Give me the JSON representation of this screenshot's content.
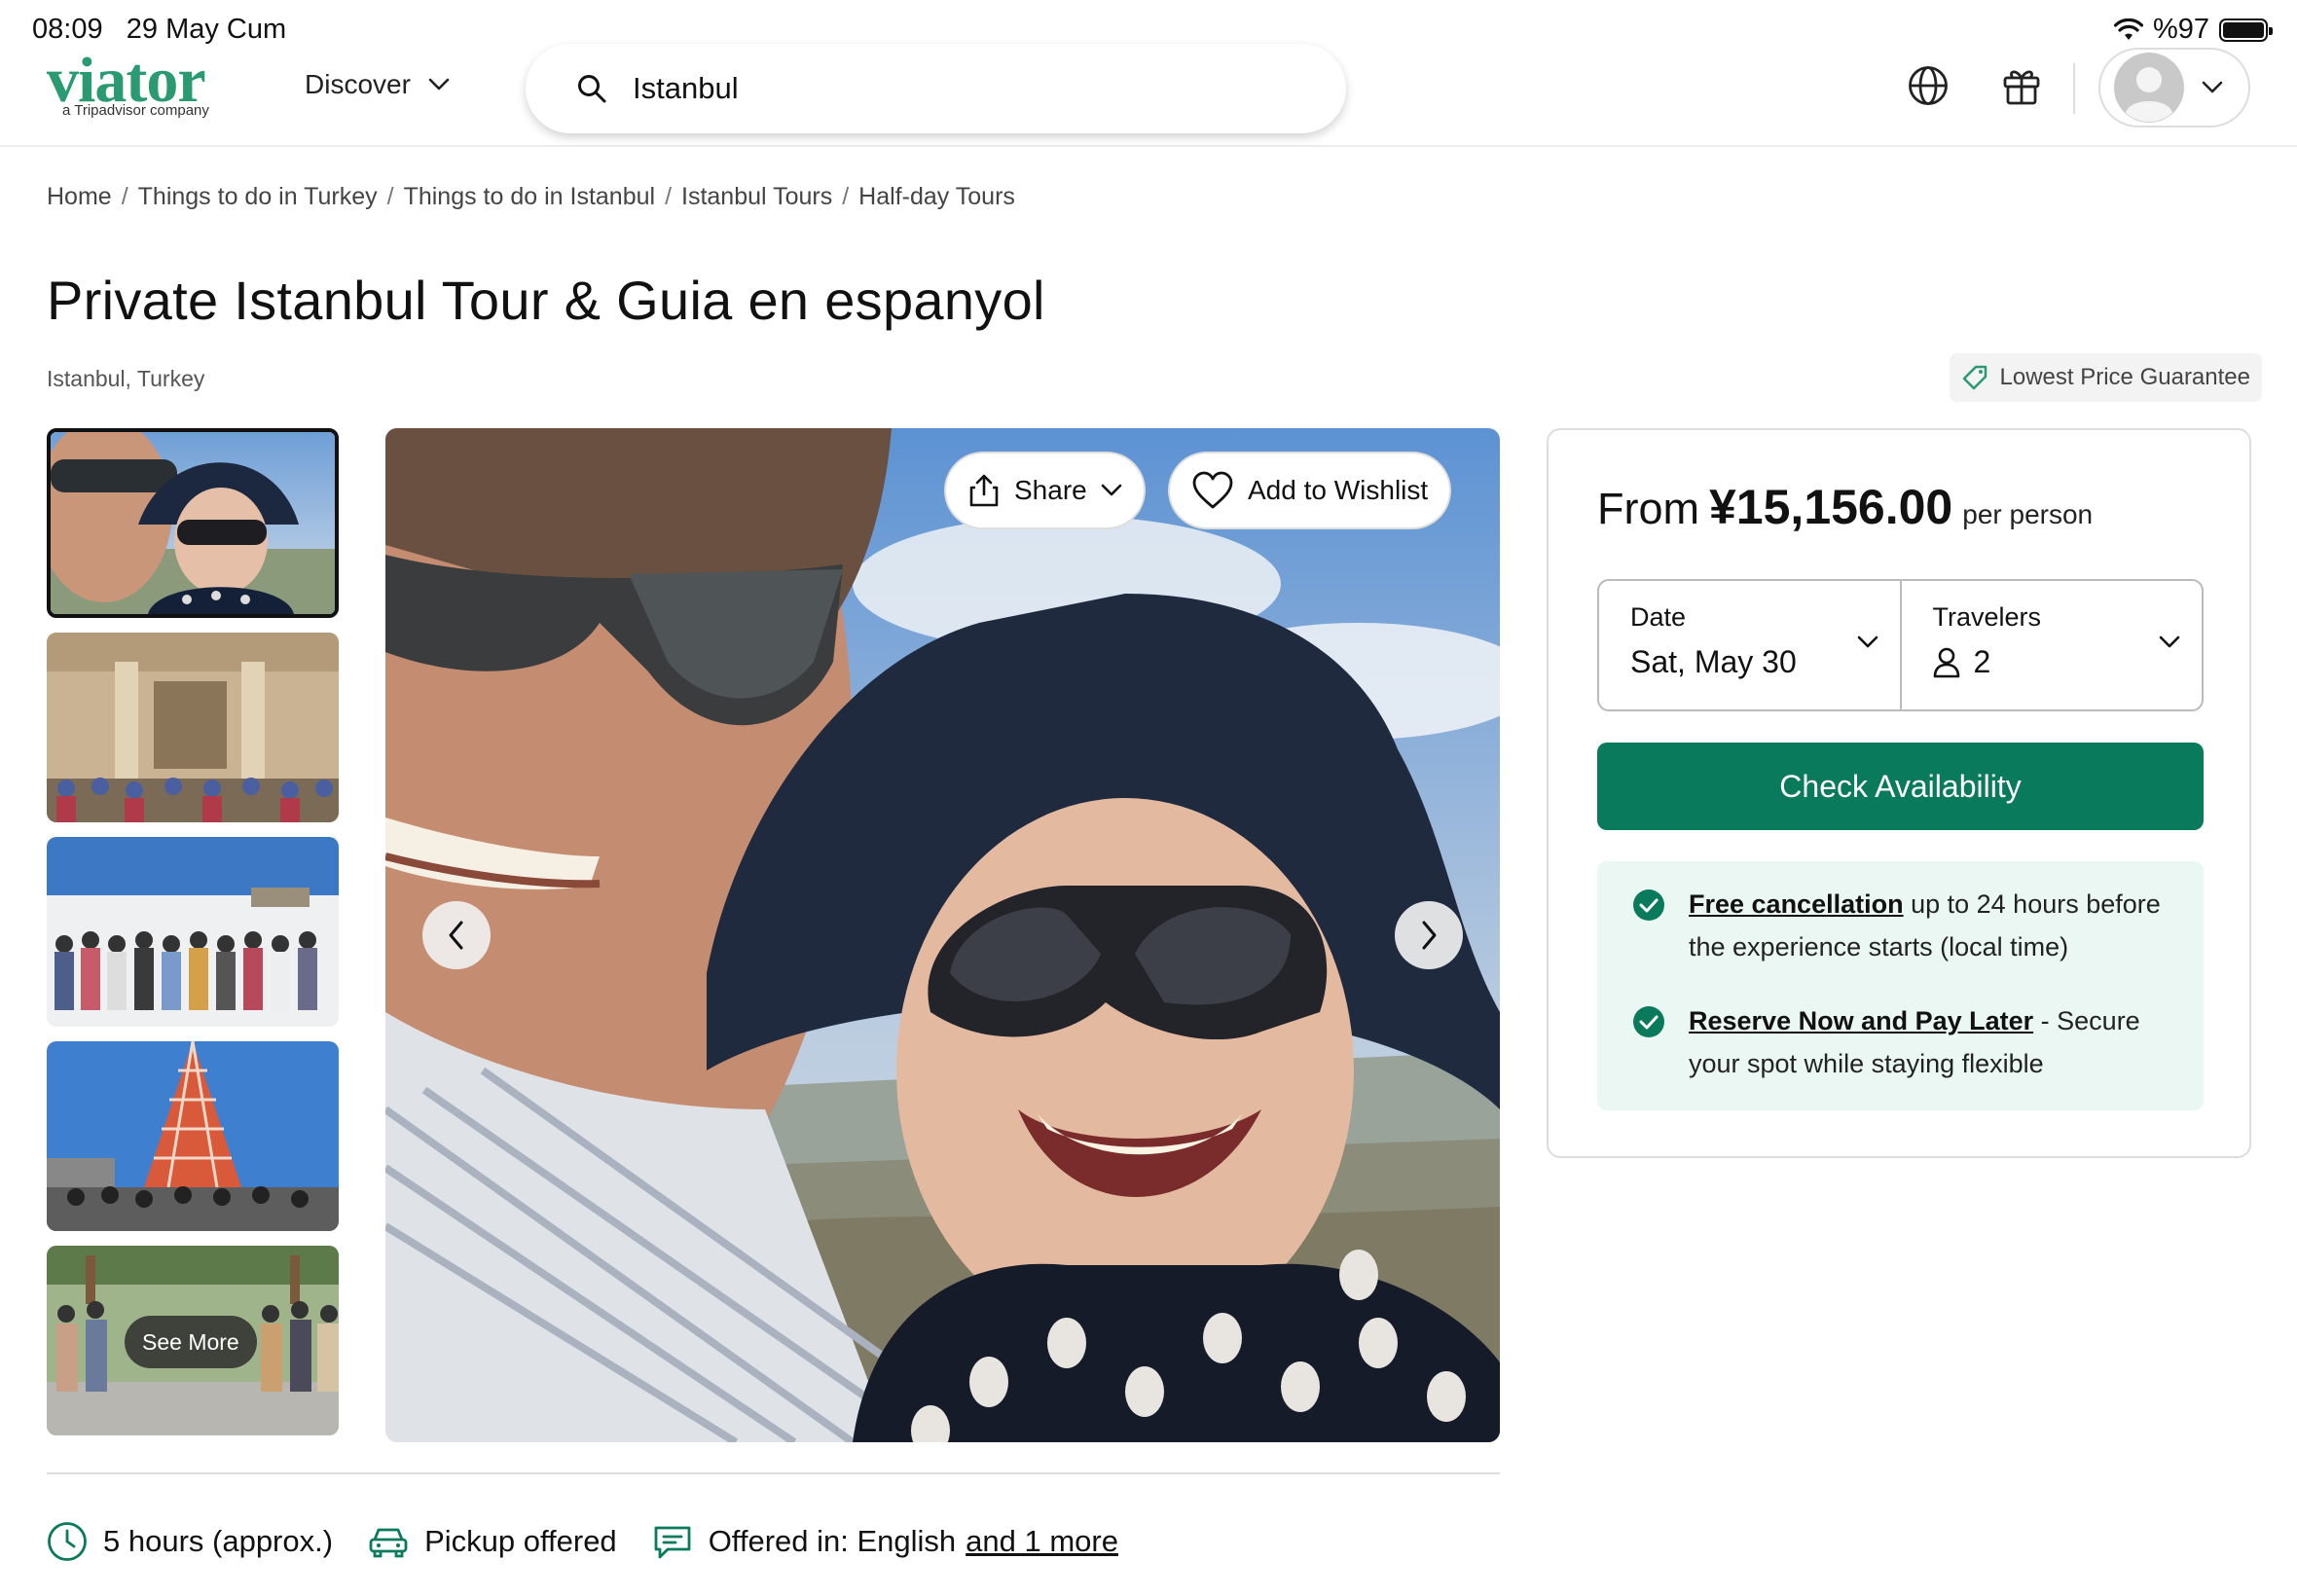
{
  "status_bar": {
    "time": "08:09",
    "date": "29 May Cum",
    "battery": "%97"
  },
  "header": {
    "logo_text": "viator",
    "logo_subtitle": "a Tripadvisor company",
    "discover_label": "Discover",
    "search_value": "Istanbul",
    "icons": [
      "globe-icon",
      "gift-icon",
      "avatar-icon",
      "chevron-down-icon"
    ]
  },
  "breadcrumb": [
    "Home",
    "Things to do in Turkey",
    "Things to do in Istanbul",
    "Istanbul Tours",
    "Half-day Tours"
  ],
  "title": "Private Istanbul Tour & Guia en espanyol",
  "location": "Istanbul, Turkey",
  "lowest_price_guarantee": "Lowest Price Guarantee",
  "gallery": {
    "see_more": "See More",
    "share_label": "Share",
    "wishlist_label": "Add to Wishlist"
  },
  "booking": {
    "from_label": "From",
    "price": "¥15,156.00",
    "per_person": "per person",
    "date_label": "Date",
    "date_value": "Sat, May 30",
    "travelers_label": "Travelers",
    "travelers_value": "2",
    "check_button": "Check Availability",
    "perks": [
      {
        "link": "Free cancellation",
        "text": " up to 24 hours before the experience starts (local time)"
      },
      {
        "link": "Reserve Now and Pay Later",
        "text": " - Secure your spot while staying flexible"
      }
    ],
    "accent_color": "#0a7a5c"
  },
  "features": {
    "duration": "5 hours (approx.)",
    "pickup": "Pickup offered",
    "offered_in": "Offered in: English",
    "more_link": "and 1 more"
  }
}
